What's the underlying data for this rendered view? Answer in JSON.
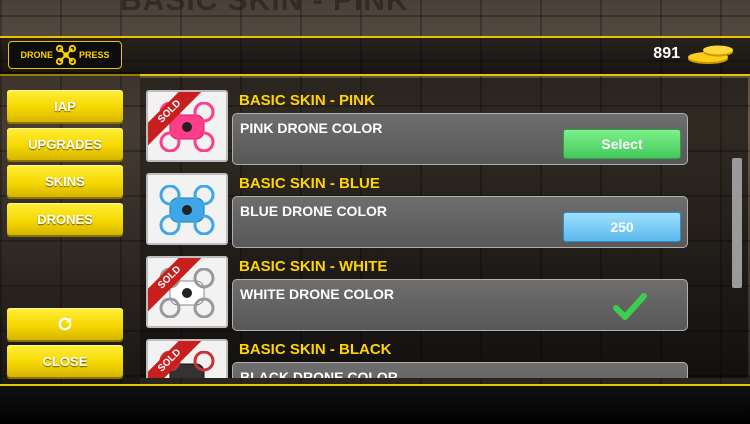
{
  "background_title": "BASIC SKIN - PINK",
  "logo": {
    "left": "DRONE",
    "right": "PRESS"
  },
  "coins": {
    "amount": "891"
  },
  "sidebar": {
    "items": [
      {
        "label": "IAP"
      },
      {
        "label": "UPGRADES"
      },
      {
        "label": "SKINS"
      },
      {
        "label": "DRONES"
      }
    ],
    "refresh_icon": "refresh-icon",
    "close_label": "CLOSE"
  },
  "skins": [
    {
      "title": "BASIC SKIN - PINK",
      "description": "PINK DRONE COLOR",
      "sold": "SOLD",
      "action": "Select",
      "action_type": "select",
      "color": "#ff3d8a"
    },
    {
      "title": "BASIC SKIN - BLUE",
      "description": "BLUE DRONE COLOR",
      "sold": "",
      "action": "250",
      "action_type": "price",
      "color": "#3fa7e8"
    },
    {
      "title": "BASIC SKIN - WHITE",
      "description": "WHITE DRONE COLOR",
      "sold": "SOLD",
      "action": "",
      "action_type": "selected",
      "color": "#ffffff"
    },
    {
      "title": "BASIC SKIN - BLACK",
      "description": "BLACK DRONE COLOR",
      "sold": "SOLD",
      "action": "",
      "action_type": "none",
      "color": "#333333"
    }
  ],
  "colors": {
    "accent": "#ffd400",
    "select": "#4fd062",
    "price": "#66c1f1",
    "sold": "#c81e1e"
  }
}
